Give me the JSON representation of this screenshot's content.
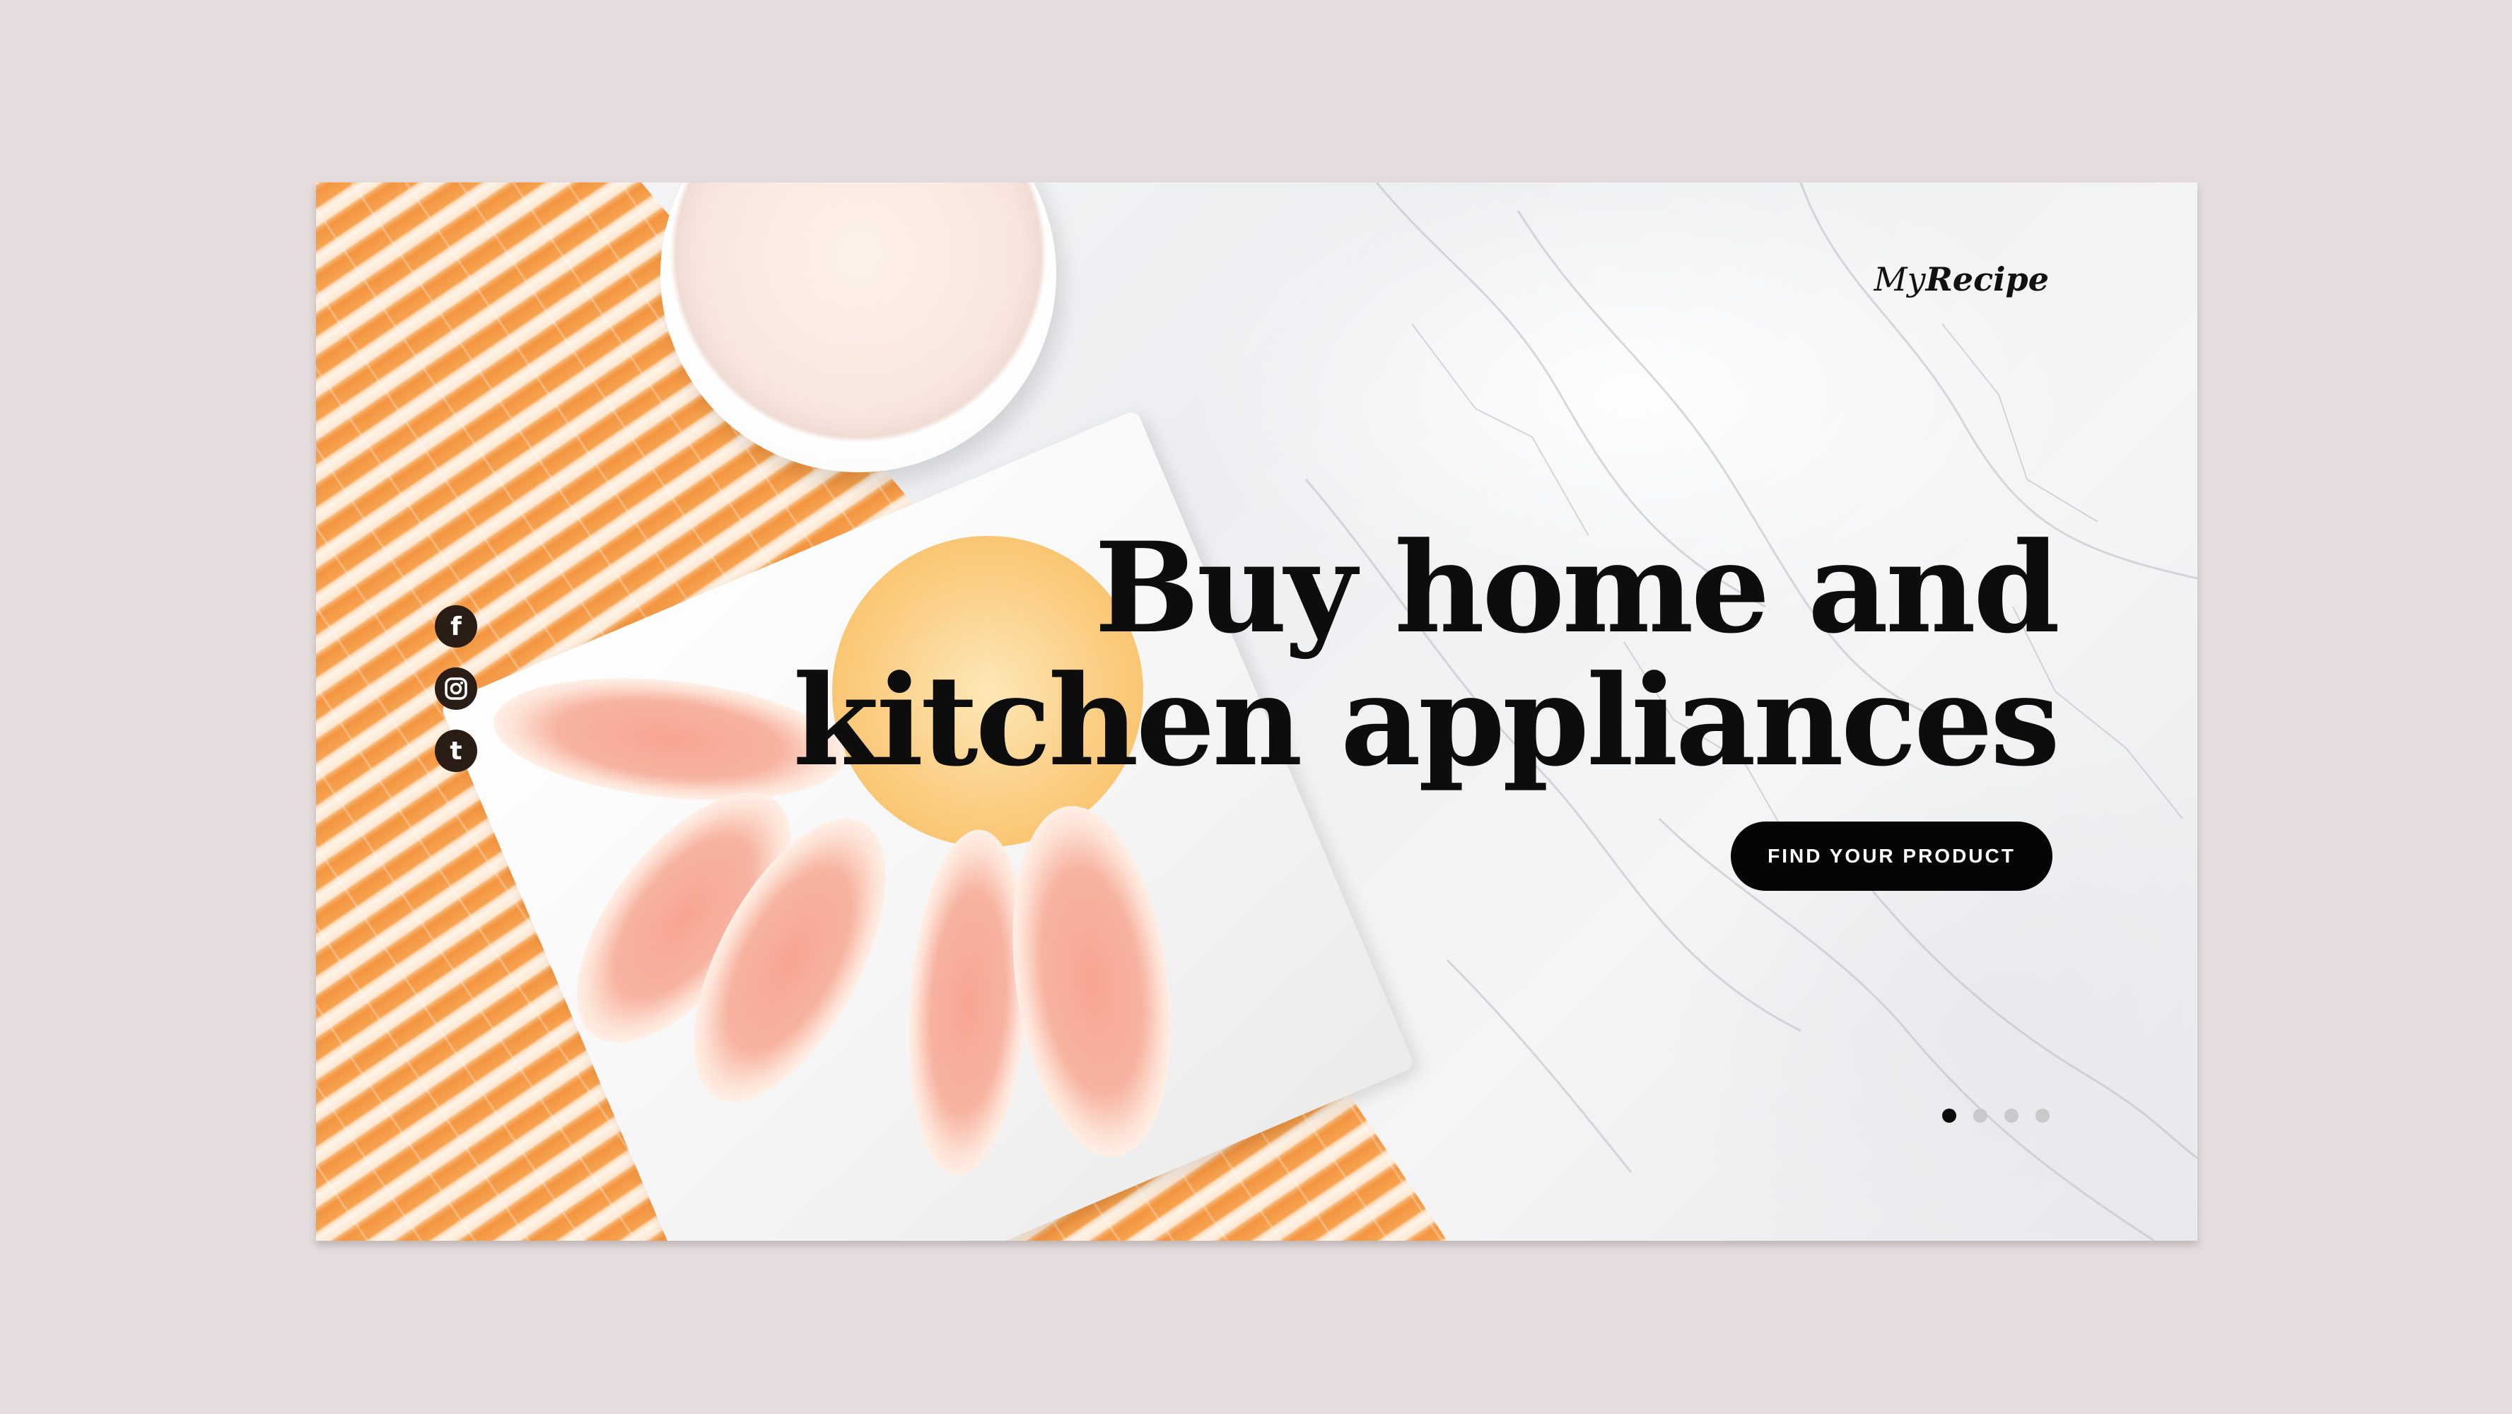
{
  "brand": {
    "logo_regular": "My",
    "logo_bold": "Recipe"
  },
  "hero": {
    "headline_line1": "Buy home and",
    "headline_line2": "kitchen appliances",
    "cta_label": "FIND YOUR PRODUCT"
  },
  "social": [
    {
      "name": "facebook-icon",
      "glyph": "f"
    },
    {
      "name": "instagram-icon",
      "glyph": ""
    },
    {
      "name": "tumblr-icon",
      "glyph": "t"
    }
  ],
  "slider": {
    "total": 4,
    "active_index": 0
  },
  "colors": {
    "background": "#e5dcdd",
    "cta": "#050505",
    "mat_orange": "#f6a24f"
  }
}
